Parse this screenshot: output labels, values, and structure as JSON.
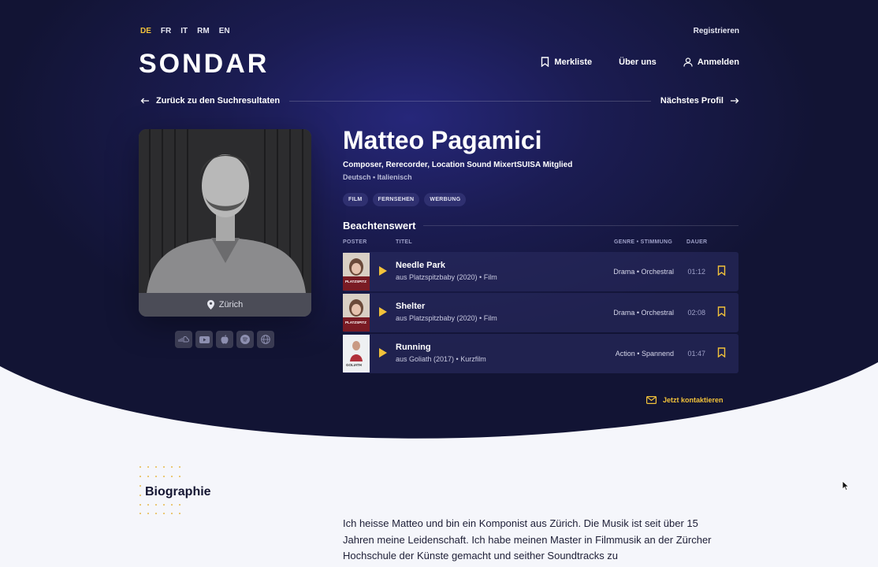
{
  "header": {
    "languages": [
      "DE",
      "FR",
      "IT",
      "RM",
      "EN"
    ],
    "active_language": "DE",
    "register_label": "Registrieren",
    "logo": "SONDAR",
    "nav": {
      "watchlist": "Merkliste",
      "about": "Über uns",
      "login": "Anmelden"
    }
  },
  "navigation": {
    "back": "Zurück zu den Suchresultaten",
    "next": "Nächstes Profil"
  },
  "profile": {
    "name": "Matteo Pagamici",
    "roles": "Composer, Rerecorder, Location Sound MixertSUISA Mitglied",
    "languages": "Deutsch • Italienisch",
    "location": "Zürich",
    "tags": [
      "FILM",
      "FERNSEHEN",
      "WERBUNG"
    ],
    "socials": [
      "soundcloud-icon",
      "youtube-icon",
      "apple-icon",
      "spotify-icon",
      "web-icon"
    ]
  },
  "notable": {
    "title": "Beachtenswert",
    "columns": {
      "poster": "POSTER",
      "title": "TITEL",
      "genre": "GENRE • STIMMUNG",
      "duration": "DAUER"
    },
    "tracks": [
      {
        "title": "Needle Park",
        "source": "aus Platzspitzbaby (2020) • Film",
        "genre": "Drama • Orchestral",
        "duration": "01:12",
        "poster_text": "PLATZSPITZ"
      },
      {
        "title": "Shelter",
        "source": "aus Platzspitzbaby (2020) • Film",
        "genre": "Drama • Orchestral",
        "duration": "02:08",
        "poster_text": "PLATZSPITZ"
      },
      {
        "title": "Running",
        "source": "aus Goliath (2017) • Kurzfilm",
        "genre": "Action • Spannend",
        "duration": "01:47",
        "poster_text": "GOLIATH"
      }
    ]
  },
  "contact_label": "Jetzt kontaktieren",
  "biography": {
    "title": "Biographie",
    "text": "Ich heisse Matteo und bin ein Komponist aus Zürich. Die Musik ist seit über 15 Jahren meine Leidenschaft. Ich habe meinen Master in Filmmusik an der Zürcher Hochschule der Künste gemacht und seither Soundtracks zu"
  },
  "colors": {
    "hero_dark": "#121434",
    "hero_mid": "#26277a",
    "accent": "#f2c23a",
    "page_bg": "#f5f6fb",
    "text_dark": "#151632"
  }
}
